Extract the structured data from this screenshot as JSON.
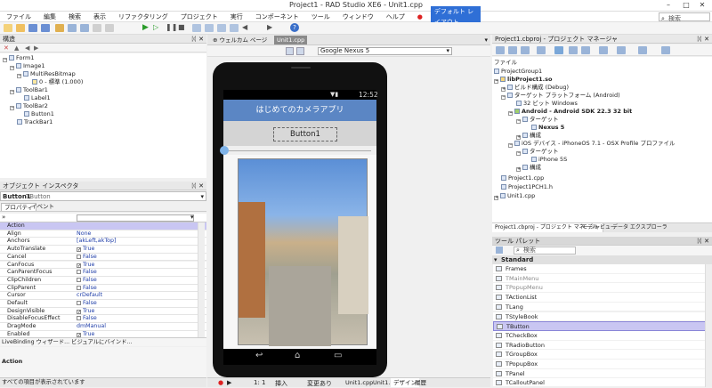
{
  "window": {
    "title": "Project1 - RAD Studio XE6 - Unit1.cpp"
  },
  "menu": [
    "ファイル",
    "編集",
    "検索",
    "表示",
    "リファクタリング",
    "プロジェクト",
    "実行",
    "コンポーネント",
    "ツール",
    "ウィンドウ",
    "ヘルプ"
  ],
  "toolbar": {
    "layout_value": "デフォルト レイアウト",
    "search_placeholder": "検索"
  },
  "structure": {
    "title": "構造",
    "nodes": [
      "Form1",
      "Image1",
      "MultiResBitmap",
      "0 - 標準 (1.000)",
      "ToolBar1",
      "Label1",
      "ToolBar2",
      "Button1",
      "TrackBar1"
    ]
  },
  "editor": {
    "tabs": [
      "ウェルカム ページ",
      "Unit1.cpp"
    ],
    "device": "Google Nexus 5"
  },
  "phone": {
    "time": "12:52",
    "title": "はじめてのカメラアプリ",
    "button": "Button1"
  },
  "inspector": {
    "title": "オブジェクト インスペクタ",
    "selected": "Button1",
    "selected_type": "TButton",
    "tabs": [
      "プロパティ",
      "イベント"
    ],
    "props": [
      {
        "n": "Action",
        "v": ""
      },
      {
        "n": "Align",
        "v": "None"
      },
      {
        "n": "Anchors",
        "v": "[akLeft,akTop]"
      },
      {
        "n": "AutoTranslate",
        "v": "True"
      },
      {
        "n": "Cancel",
        "v": "False"
      },
      {
        "n": "CanFocus",
        "v": "True"
      },
      {
        "n": "CanParentFocus",
        "v": "False"
      },
      {
        "n": "ClipChildren",
        "v": "False"
      },
      {
        "n": "ClipParent",
        "v": "False"
      },
      {
        "n": "Cursor",
        "v": "crDefault"
      },
      {
        "n": "Default",
        "v": "False"
      },
      {
        "n": "DesignVisible",
        "v": "True"
      },
      {
        "n": "DisableFocusEffect",
        "v": "False"
      },
      {
        "n": "DragMode",
        "v": "dmManual"
      },
      {
        "n": "Enabled",
        "v": "True"
      }
    ],
    "livebinding": "LiveBinding ウィザード...  ビジュアルにバインド...",
    "desc_title": "Action",
    "status": "すべての項目が表示されています"
  },
  "status": {
    "pos": "1:  1",
    "mode": "挿入",
    "modified": "変更あり",
    "tabs": [
      "Unit1.cpp",
      "Unit1.h",
      "デザイン",
      "履歴"
    ]
  },
  "project": {
    "title": "Project1.cbproj - プロジェクト マネージャ",
    "file_label": "ファイル",
    "nodes": [
      "ProjectGroup1",
      "libProject1.so",
      "ビルド構成 (Debug)",
      "ターゲット プラットフォーム (Android)",
      "32 ビット Windows",
      "Android - Android SDK 22.3 32 bit",
      "ターゲット",
      "Nexus 5",
      "構成",
      "iOS デバイス - iPhoneOS 7.1 - OSX Profile プロファイル",
      "ターゲット",
      "iPhone 5S",
      "構成",
      "Project1.cpp",
      "Project1PCH1.h",
      "Unit1.cpp"
    ],
    "tabs": [
      "Project1.cbproj - プロジェクト マネージャ",
      "モデル ビュー",
      "データ エクスプローラ"
    ]
  },
  "palette": {
    "title": "ツール パレット",
    "search_placeholder": "検索",
    "category": "Standard",
    "items": [
      "Frames",
      "TMainMenu",
      "TPopupMenu",
      "TActionList",
      "TLang",
      "TStyleBook",
      "TButton",
      "TCheckBox",
      "TRadioButton",
      "TGroupBox",
      "TPopupBox",
      "TPanel",
      "TCalloutPanel"
    ]
  },
  "colors": {
    "phone_bar": "#5b86c4",
    "selected": "#c9c6f2"
  }
}
